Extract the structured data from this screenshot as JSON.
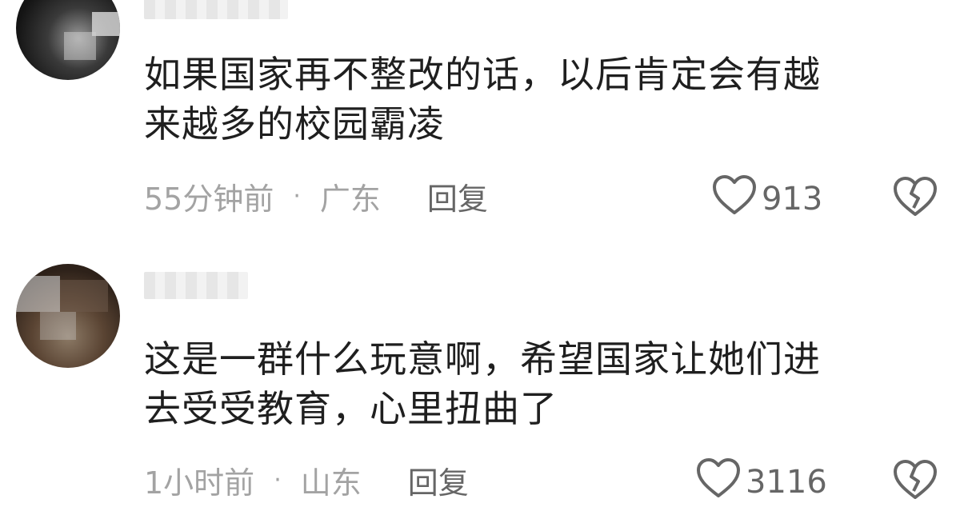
{
  "comments": [
    {
      "text_line1": "如果国家再不整改的话，以后肯定会有越",
      "text_line2": "来越多的校园霸凌",
      "time": "55分钟前",
      "separator": "·",
      "region": "广东",
      "reply_label": "回复",
      "likes": "913",
      "avatar_icon": "user-avatar",
      "like_icon": "heart-outline-icon",
      "dislike_icon": "broken-heart-icon"
    },
    {
      "text_line1": "这是一群什么玩意啊，希望国家让她们进",
      "text_line2": "去受受教育，心里扭曲了",
      "time": "1小时前",
      "separator": "·",
      "region": "山东",
      "reply_label": "回复",
      "likes": "3116",
      "avatar_icon": "user-avatar",
      "like_icon": "heart-outline-icon",
      "dislike_icon": "broken-heart-icon"
    }
  ],
  "colors": {
    "text": "#1f1f1f",
    "meta": "#a3a3a3",
    "action": "#666666",
    "background": "#ffffff"
  }
}
